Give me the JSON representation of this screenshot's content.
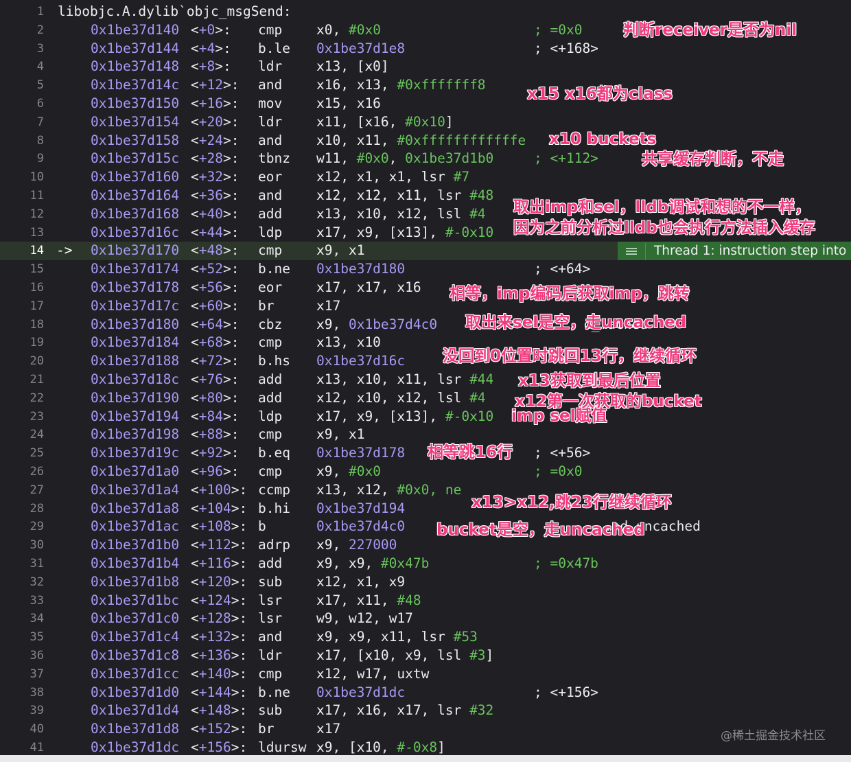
{
  "header": {
    "line": "1",
    "text": "libobjc.A.dylib`objc_msgSend:"
  },
  "current_line": "14",
  "instructions": [
    {
      "line": "2",
      "addr": "0x1be37d140",
      "off": "+0",
      "mn": "cmp",
      "ops": [
        [
          "x0, ",
          ""
        ],
        [
          "#0x0",
          "num"
        ]
      ],
      "cm": "; =0x0",
      "cmg": true
    },
    {
      "line": "3",
      "addr": "0x1be37d144",
      "off": "+4",
      "mn": "b.le",
      "ops": [
        [
          "0x1be37d1e8",
          "tgt"
        ]
      ],
      "cm": "; <+168>"
    },
    {
      "line": "4",
      "addr": "0x1be37d148",
      "off": "+8",
      "mn": "ldr",
      "ops": [
        [
          "x13, [x0]",
          ""
        ]
      ]
    },
    {
      "line": "5",
      "addr": "0x1be37d14c",
      "off": "+12",
      "mn": "and",
      "ops": [
        [
          "x16, x13, ",
          ""
        ],
        [
          "#0xfffffff8",
          "num"
        ]
      ]
    },
    {
      "line": "6",
      "addr": "0x1be37d150",
      "off": "+16",
      "mn": "mov",
      "ops": [
        [
          "x15, x16",
          ""
        ]
      ]
    },
    {
      "line": "7",
      "addr": "0x1be37d154",
      "off": "+20",
      "mn": "ldr",
      "ops": [
        [
          "x11, [x16, ",
          ""
        ],
        [
          "#0x10",
          "num"
        ],
        [
          "]",
          ""
        ]
      ]
    },
    {
      "line": "8",
      "addr": "0x1be37d158",
      "off": "+24",
      "mn": "and",
      "ops": [
        [
          "x10, x11, ",
          ""
        ],
        [
          "#0xffffffffffffe",
          "num"
        ]
      ]
    },
    {
      "line": "9",
      "addr": "0x1be37d15c",
      "off": "+28",
      "mn": "tbnz",
      "ops": [
        [
          "w11, ",
          ""
        ],
        [
          "#0x0",
          "num"
        ],
        [
          ", ",
          ""
        ],
        [
          "0x1be37d1b0",
          "num"
        ]
      ],
      "cm": "; <+112>",
      "cmg": true
    },
    {
      "line": "10",
      "addr": "0x1be37d160",
      "off": "+32",
      "mn": "eor",
      "ops": [
        [
          "x12, x1, x1, lsr ",
          ""
        ],
        [
          "#7",
          "num"
        ]
      ]
    },
    {
      "line": "11",
      "addr": "0x1be37d164",
      "off": "+36",
      "mn": "and",
      "ops": [
        [
          "x12, x12, x11, lsr ",
          ""
        ],
        [
          "#48",
          "num"
        ]
      ]
    },
    {
      "line": "12",
      "addr": "0x1be37d168",
      "off": "+40",
      "mn": "add",
      "ops": [
        [
          "x13, x10, x12, lsl ",
          ""
        ],
        [
          "#4",
          "num"
        ]
      ]
    },
    {
      "line": "13",
      "addr": "0x1be37d16c",
      "off": "+44",
      "mn": "ldp",
      "ops": [
        [
          "x17, x9, [x13], ",
          ""
        ],
        [
          "#-0x10",
          "num"
        ]
      ]
    },
    {
      "line": "14",
      "addr": "0x1be37d170",
      "off": "+48",
      "mn": "cmp",
      "ops": [
        [
          "x9, x1",
          ""
        ]
      ],
      "current": true
    },
    {
      "line": "15",
      "addr": "0x1be37d174",
      "off": "+52",
      "mn": "b.ne",
      "ops": [
        [
          "0x1be37d180",
          "tgt"
        ]
      ],
      "cm": "; <+64>"
    },
    {
      "line": "16",
      "addr": "0x1be37d178",
      "off": "+56",
      "mn": "eor",
      "ops": [
        [
          "x17, x17, x16",
          ""
        ]
      ]
    },
    {
      "line": "17",
      "addr": "0x1be37d17c",
      "off": "+60",
      "mn": "br",
      "ops": [
        [
          "x17",
          ""
        ]
      ]
    },
    {
      "line": "18",
      "addr": "0x1be37d180",
      "off": "+64",
      "mn": "cbz",
      "ops": [
        [
          "x9, ",
          ""
        ],
        [
          "0x1be37d4c0",
          "tgt"
        ]
      ]
    },
    {
      "line": "19",
      "addr": "0x1be37d184",
      "off": "+68",
      "mn": "cmp",
      "ops": [
        [
          "x13, x10",
          ""
        ]
      ]
    },
    {
      "line": "20",
      "addr": "0x1be37d188",
      "off": "+72",
      "mn": "b.hs",
      "ops": [
        [
          "0x1be37d16c",
          "tgt"
        ]
      ]
    },
    {
      "line": "21",
      "addr": "0x1be37d18c",
      "off": "+76",
      "mn": "add",
      "ops": [
        [
          "x13, x10, x11, lsr ",
          ""
        ],
        [
          "#44",
          "num"
        ]
      ]
    },
    {
      "line": "22",
      "addr": "0x1be37d190",
      "off": "+80",
      "mn": "add",
      "ops": [
        [
          "x12, x10, x12, lsl ",
          ""
        ],
        [
          "#4",
          "num"
        ]
      ]
    },
    {
      "line": "23",
      "addr": "0x1be37d194",
      "off": "+84",
      "mn": "ldp",
      "ops": [
        [
          "x17, x9, [x13], ",
          ""
        ],
        [
          "#-0x10",
          "num"
        ]
      ]
    },
    {
      "line": "24",
      "addr": "0x1be37d198",
      "off": "+88",
      "mn": "cmp",
      "ops": [
        [
          "x9, x1",
          ""
        ]
      ]
    },
    {
      "line": "25",
      "addr": "0x1be37d19c",
      "off": "+92",
      "mn": "b.eq",
      "ops": [
        [
          "0x1be37d178",
          "tgt"
        ]
      ],
      "cm": "; <+56>"
    },
    {
      "line": "26",
      "addr": "0x1be37d1a0",
      "off": "+96",
      "mn": "cmp",
      "ops": [
        [
          "x9, ",
          ""
        ],
        [
          "#0x0",
          "num"
        ]
      ],
      "cm": "; =0x0",
      "cmg": true
    },
    {
      "line": "27",
      "addr": "0x1be37d1a4",
      "off": "+100",
      "mn": "ccmp",
      "ops": [
        [
          "x13, x12, ",
          ""
        ],
        [
          "#0x0, ne",
          "num"
        ]
      ]
    },
    {
      "line": "28",
      "addr": "0x1be37d1a8",
      "off": "+104",
      "mn": "b.hi",
      "ops": [
        [
          "0x1be37d194",
          "tgt"
        ]
      ]
    },
    {
      "line": "29",
      "addr": "0x1be37d1ac",
      "off": "+108",
      "mn": "b",
      "ops": [
        [
          "0x1be37d4c0",
          "tgt"
        ]
      ]
    },
    {
      "line": "30",
      "addr": "0x1be37d1b0",
      "off": "+112",
      "mn": "adrp",
      "ops": [
        [
          "x9, ",
          ""
        ],
        [
          "227000",
          "tgt"
        ]
      ]
    },
    {
      "line": "31",
      "addr": "0x1be37d1b4",
      "off": "+116",
      "mn": "add",
      "ops": [
        [
          "x9, x9, ",
          ""
        ],
        [
          "#0x47b",
          "num"
        ]
      ],
      "cm": "; =0x47b",
      "cmg": true
    },
    {
      "line": "32",
      "addr": "0x1be37d1b8",
      "off": "+120",
      "mn": "sub",
      "ops": [
        [
          "x12, x1, x9",
          ""
        ]
      ]
    },
    {
      "line": "33",
      "addr": "0x1be37d1bc",
      "off": "+124",
      "mn": "lsr",
      "ops": [
        [
          "x17, x11, ",
          ""
        ],
        [
          "#48",
          "num"
        ]
      ]
    },
    {
      "line": "34",
      "addr": "0x1be37d1c0",
      "off": "+128",
      "mn": "lsr",
      "ops": [
        [
          "w9, w12, w17",
          ""
        ]
      ]
    },
    {
      "line": "35",
      "addr": "0x1be37d1c4",
      "off": "+132",
      "mn": "and",
      "ops": [
        [
          "x9, x9, x11, lsr ",
          ""
        ],
        [
          "#53",
          "num"
        ]
      ]
    },
    {
      "line": "36",
      "addr": "0x1be37d1c8",
      "off": "+136",
      "mn": "ldr",
      "ops": [
        [
          "x17, [x10, x9, lsl ",
          ""
        ],
        [
          "#3",
          "num"
        ],
        [
          "]",
          ""
        ]
      ]
    },
    {
      "line": "37",
      "addr": "0x1be37d1cc",
      "off": "+140",
      "mn": "cmp",
      "ops": [
        [
          "x12, w17, uxtw",
          ""
        ]
      ]
    },
    {
      "line": "38",
      "addr": "0x1be37d1d0",
      "off": "+144",
      "mn": "b.ne",
      "ops": [
        [
          "0x1be37d1dc",
          "tgt"
        ]
      ],
      "cm": "; <+156>"
    },
    {
      "line": "39",
      "addr": "0x1be37d1d4",
      "off": "+148",
      "mn": "sub",
      "ops": [
        [
          "x17, x16, x17, lsr ",
          ""
        ],
        [
          "#32",
          "num"
        ]
      ]
    },
    {
      "line": "40",
      "addr": "0x1be37d1d8",
      "off": "+152",
      "mn": "br",
      "ops": [
        [
          "x17",
          ""
        ]
      ]
    },
    {
      "line": "41",
      "addr": "0x1be37d1dc",
      "off": "+156",
      "mn": "ldursw",
      "ops": [
        [
          "x9, [x10, ",
          ""
        ],
        [
          "#-0x8",
          "num"
        ],
        [
          "]",
          ""
        ]
      ]
    }
  ],
  "annotations": [
    {
      "text": "判断receiver是否为nil"
    },
    {
      "text": "x15 x16都为class"
    },
    {
      "text": "x10 buckets"
    },
    {
      "text": "共享缓存判断，不走"
    },
    {
      "text": "取出imp和sel，lldb调试和想的不一样，"
    },
    {
      "text": "因为之前分析过lldb也会执行方法插入缓存"
    },
    {
      "text": "相等，imp编码后获取imp，跳转"
    },
    {
      "text": "取出来sel是空，走uncached"
    },
    {
      "text": "没回到0位置时跳回13行，继续循环"
    },
    {
      "text": "x13获取到最后位置"
    },
    {
      "text": "x12第一次获取的bucket"
    },
    {
      "text": "imp sel赋值"
    },
    {
      "text": "相等跳16行"
    },
    {
      "text": "x13>x12,跳23行继续循环"
    },
    {
      "text": "bucket是空，走uncached"
    }
  ],
  "partial_comments": [
    "c_…ached",
    "…nd_uncached"
  ],
  "thread_badge": {
    "text": "Thread 1: instruction step into",
    "icon": "lines-icon"
  },
  "arrow": "->",
  "watermark": "@稀土掘金技术社区"
}
